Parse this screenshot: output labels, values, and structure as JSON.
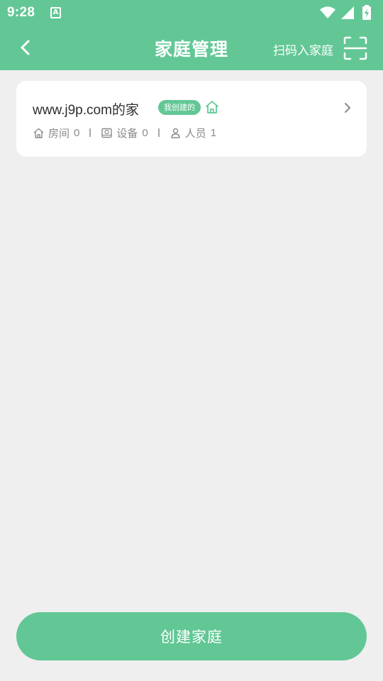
{
  "status_bar": {
    "time": "9:28",
    "app_icon_letter": "A",
    "icons": [
      "wifi-icon",
      "cell-signal-icon",
      "battery-charging-icon"
    ]
  },
  "nav": {
    "back_icon": "chevron-left-icon",
    "title": "家庭管理",
    "scan_label": "扫码入家庭",
    "scan_icon": "scan-frame-icon"
  },
  "home_card": {
    "name": "www.j9p.com的家",
    "badge": "我创建的",
    "badge_icon": "home-icon",
    "chevron_icon": "chevron-right-icon",
    "stats": [
      {
        "icon": "home-outline-icon",
        "label": "房间",
        "count": "0"
      },
      {
        "icon": "device-icon",
        "label": "设备",
        "count": "0"
      },
      {
        "icon": "person-icon",
        "label": "人员",
        "count": "1"
      }
    ]
  },
  "create_button": {
    "label": "创建家庭"
  },
  "colors": {
    "brand": "#62c795",
    "background": "#efefef",
    "card": "#ffffff",
    "text_primary": "#2e2e2e",
    "text_secondary": "#8a8a8a"
  }
}
